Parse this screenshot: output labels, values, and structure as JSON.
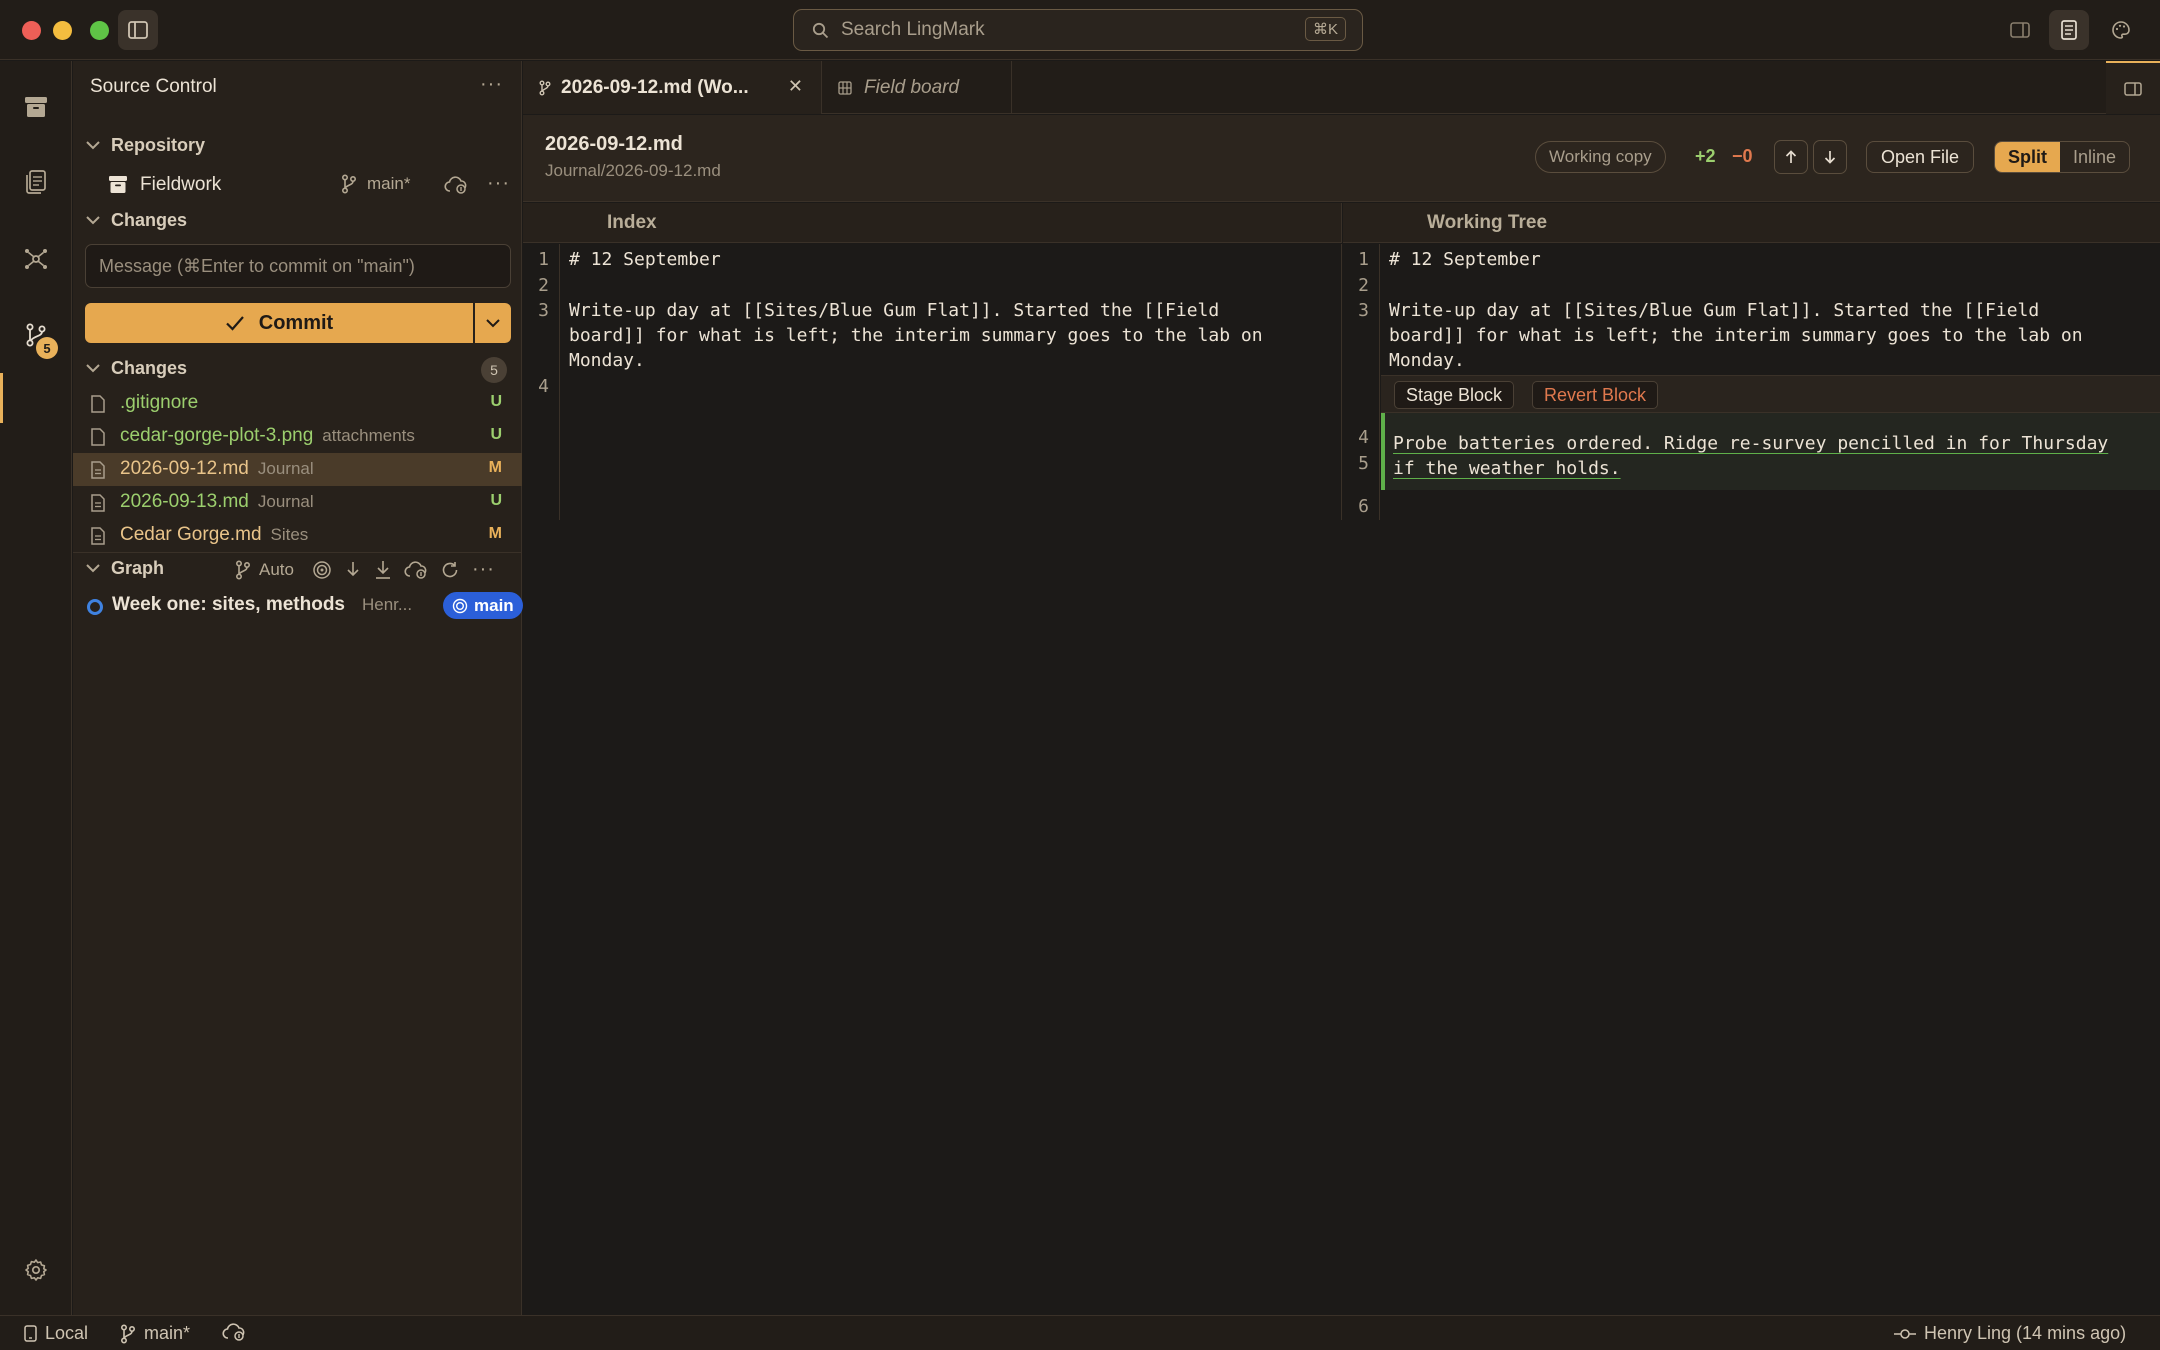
{
  "search": {
    "placeholder": "Search LingMark",
    "shortcut": "⌘K"
  },
  "activity": {
    "source_control_badge": "5"
  },
  "sidebar": {
    "title": "Source Control",
    "repository_section": "Repository",
    "repo": {
      "name": "Fieldwork",
      "branch": "main*"
    },
    "changes_section": "Changes",
    "commit_message_placeholder": "Message (⌘Enter to commit on \"main\")",
    "commit_label": "Commit",
    "changes_list_section": "Changes",
    "changes_count": "5",
    "files": [
      {
        "name": ".gitignore",
        "dir": "",
        "status": "U"
      },
      {
        "name": "cedar-gorge-plot-3.png",
        "dir": "attachments",
        "status": "U"
      },
      {
        "name": "2026-09-12.md",
        "dir": "Journal",
        "status": "M"
      },
      {
        "name": "2026-09-13.md",
        "dir": "Journal",
        "status": "U"
      },
      {
        "name": "Cedar Gorge.md",
        "dir": "Sites",
        "status": "M"
      }
    ],
    "graph_section": "Graph",
    "graph_auto": "Auto",
    "graph_commit": {
      "message": "Week one: sites, methods",
      "author": "Henr...",
      "branch": "main"
    }
  },
  "tabs": [
    {
      "label": "2026-09-12.md (Wo..."
    },
    {
      "label": "Field board"
    }
  ],
  "diff": {
    "file_title": "2026-09-12.md",
    "file_path": "Journal/2026-09-12.md",
    "working_copy": "Working copy",
    "additions": "+2",
    "deletions": "−0",
    "open_file": "Open File",
    "split": "Split",
    "inline": "Inline",
    "left_header": "Index",
    "right_header": "Working Tree",
    "left_lines": {
      "n1": "1",
      "n2": "2",
      "n3": "3",
      "n4": "4",
      "l1": "# 12 September",
      "l3a": "Write-up day at [[Sites/Blue Gum Flat]]. Started the [[Field",
      "l3b": "board]] for what is left; the interim summary goes to the lab on",
      "l3c": "Monday."
    },
    "right_lines": {
      "n1": "1",
      "n2": "2",
      "n3": "3",
      "n4": "4",
      "n5": "5",
      "n6": "6",
      "l1": "# 12 September",
      "l3a": "Write-up day at [[Sites/Blue Gum Flat]]. Started the [[Field",
      "l3b": "board]] for what is left; the interim summary goes to the lab on",
      "l3c": "Monday.",
      "l5a": "Probe batteries ordered. Ridge re-survey pencilled in for Thursday",
      "l5b": "if the weather holds."
    },
    "stage_block": "Stage Block",
    "revert_block": "Revert Block"
  },
  "statusbar": {
    "location": "Local",
    "branch": "main*",
    "author": "Henry Ling (14 mins ago)"
  },
  "colors": {
    "accent": "#e6a84f",
    "added": "#9ccf6e",
    "modified": "#e9b15a",
    "deleted": "#e0794e",
    "branch": "#2b5fd9"
  }
}
